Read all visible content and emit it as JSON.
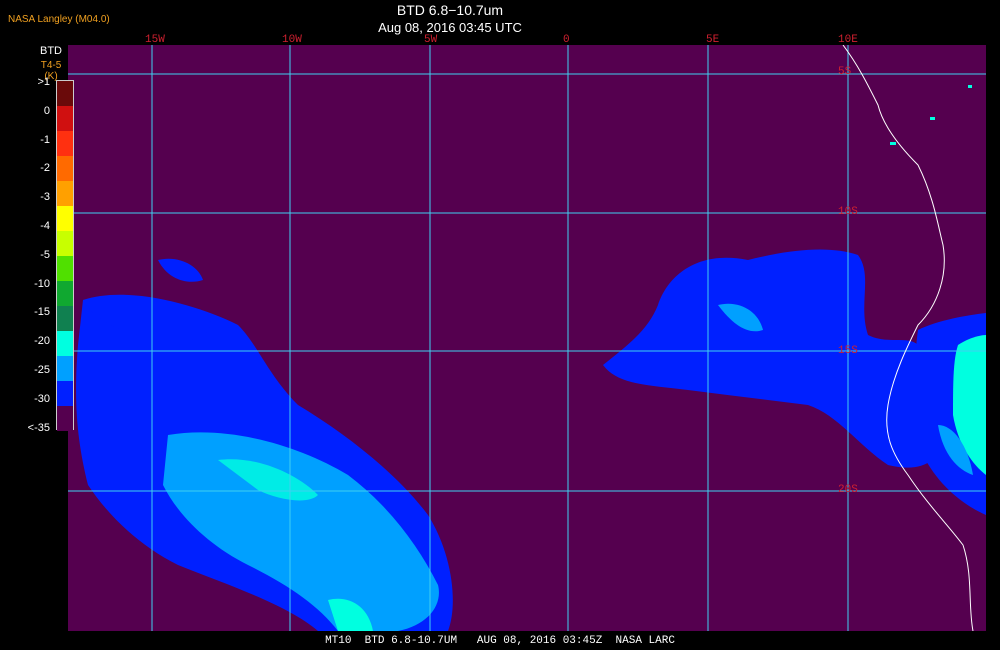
{
  "header": {
    "source": "NASA Langley (M04.0)",
    "title": "BTD 6.8−10.7um",
    "timestamp": "Aug 08, 2016 03:45 UTC"
  },
  "legend": {
    "title": "BTD",
    "units": "T4-5 (K)",
    "labels": [
      ">1",
      "0",
      "-1",
      "-2",
      "-3",
      "-4",
      "-5",
      "-10",
      "-15",
      "-20",
      "-25",
      "-30",
      "<-35"
    ],
    "colors": [
      "#6a0a0a",
      "#d01010",
      "#ff3010",
      "#ff6a00",
      "#ffa000",
      "#ffff00",
      "#c8ff00",
      "#50e000",
      "#10a830",
      "#108050",
      "#00ffe0",
      "#00a0ff",
      "#0020ff",
      "#55004f"
    ]
  },
  "map": {
    "background_color": "#55004f",
    "grid_color": "#40d0f0",
    "coast_color": "#ffffff",
    "longitude_labels": [
      "15W",
      "10W",
      "5W",
      "0",
      "5E",
      "10E"
    ],
    "latitude_labels": [
      "5S",
      "10S",
      "15S",
      "20S"
    ]
  },
  "footer": {
    "text": "MT10  BTD 6.8-10.7UM   AUG 08, 2016 03:45Z  NASA LARC"
  }
}
